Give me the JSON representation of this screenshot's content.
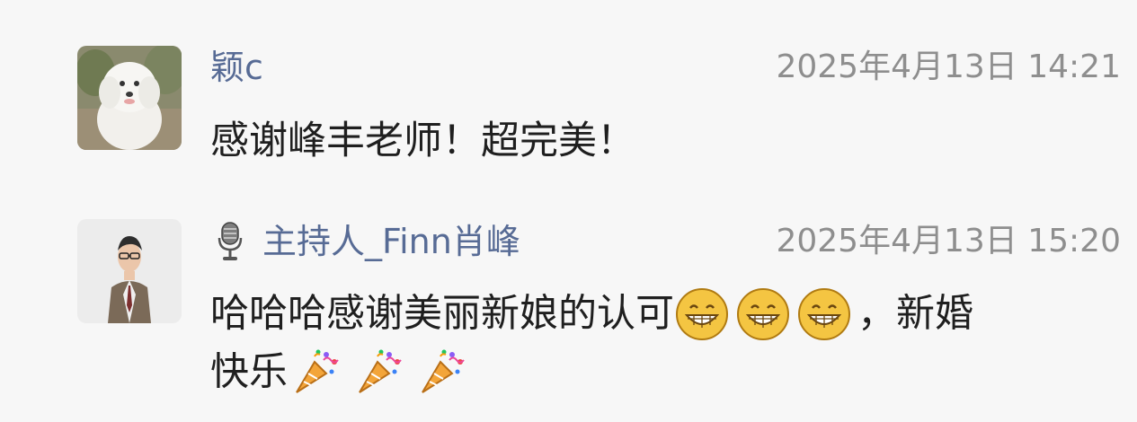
{
  "comments": [
    {
      "username": "颖c",
      "timestamp": "2025年4月13日 14:21",
      "content": "感谢峰丰老师！超完美！",
      "avatar_icon": "fluffy-white-dog-avatar"
    },
    {
      "username": "主持人_Finn肖峰",
      "timestamp": "2025年4月13日 15:20",
      "content_line1_text": "哈哈哈感谢美丽新娘的认可",
      "content_line1_suffix": "，新婚",
      "content_line2_text": "快乐",
      "avatar_icon": "man-in-suit-avatar",
      "name_icon": "microphone-icon",
      "emoji_line1": [
        "grinning-face-icon",
        "grinning-face-icon",
        "grinning-face-icon"
      ],
      "emoji_line2": [
        "party-popper-icon",
        "party-popper-icon",
        "party-popper-icon"
      ]
    }
  ],
  "colors": {
    "background": "#f7f7f7",
    "username": "#576b95",
    "timestamp": "#8e8e8e",
    "content": "#1f1f1f"
  }
}
